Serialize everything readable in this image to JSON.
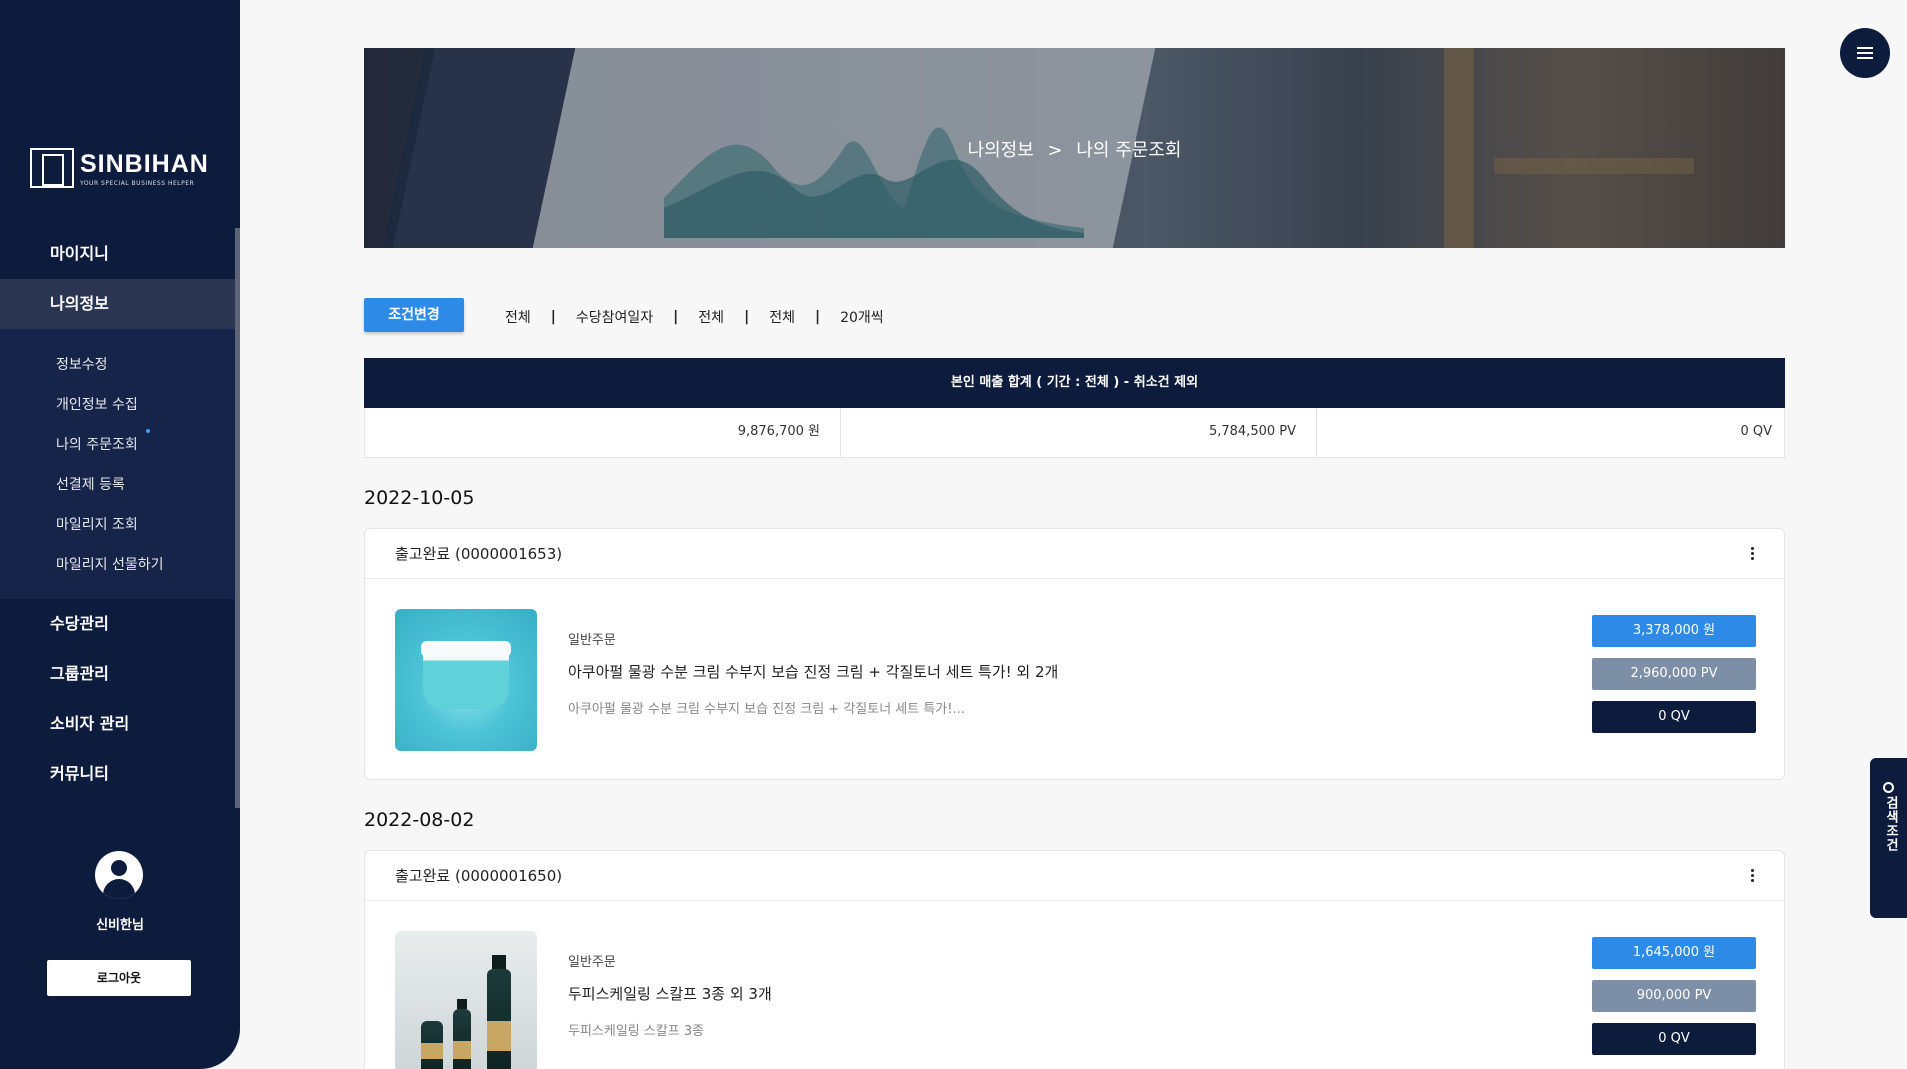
{
  "brand": {
    "name": "SINBIHAN",
    "tagline": "YOUR SPECIAL BUSINESS HELPER"
  },
  "sidebar": {
    "menu": [
      {
        "label": "마이지니"
      },
      {
        "label": "나의정보"
      },
      {
        "label": "수당관리"
      },
      {
        "label": "그룹관리"
      },
      {
        "label": "소비자 관리"
      },
      {
        "label": "커뮤니티"
      }
    ],
    "submenu": [
      {
        "label": "정보수정"
      },
      {
        "label": "개인정보 수집"
      },
      {
        "label": "나의 주문조회"
      },
      {
        "label": "선결제 등록"
      },
      {
        "label": "마일리지 조회"
      },
      {
        "label": "마일리지 선물하기"
      }
    ],
    "user_name": "신비한님",
    "logout_label": "로그아웃"
  },
  "banner": {
    "crumb_parent": "나의정보",
    "crumb_sep": ">",
    "crumb_current": "나의 주문조회"
  },
  "filter": {
    "button_label": "조건변경",
    "values": [
      "전체",
      "수당참여일자",
      "전체",
      "전체",
      "20개씩"
    ],
    "separator": "|"
  },
  "summary": {
    "header": "본인 매출 합계 ( 기간 : 전체 ) - 취소건 제외",
    "amount": "9,876,700 원",
    "pv": "5,784,500 PV",
    "qv": "0 QV"
  },
  "orders": [
    {
      "date": "2022-10-05",
      "status": "출고완료 (0000001653)",
      "type": "일반주문",
      "title": "아쿠아펄 물광 수분 크림 수부지 보습 진정 크림 + 각질토너 세트 특가! 외 2개",
      "desc": "아쿠아펄 물광 수분 크림 수부지 보습 진정 크림 + 각질토너 세트 특가!...",
      "amount": "3,378,000 원",
      "pv": "2,960,000 PV",
      "qv": "0 QV"
    },
    {
      "date": "2022-08-02",
      "status": "출고완료 (0000001650)",
      "type": "일반주문",
      "title": "두피스케일링 스칼프 3종 외 3개",
      "desc": "두피스케일링 스칼프 3종",
      "amount": "1,645,000 원",
      "pv": "900,000 PV",
      "qv": "0 QV"
    }
  ],
  "search_tab_label": "검색조건",
  "icons": [
    "menu-icon",
    "search-icon",
    "user-icon",
    "more-icon"
  ]
}
